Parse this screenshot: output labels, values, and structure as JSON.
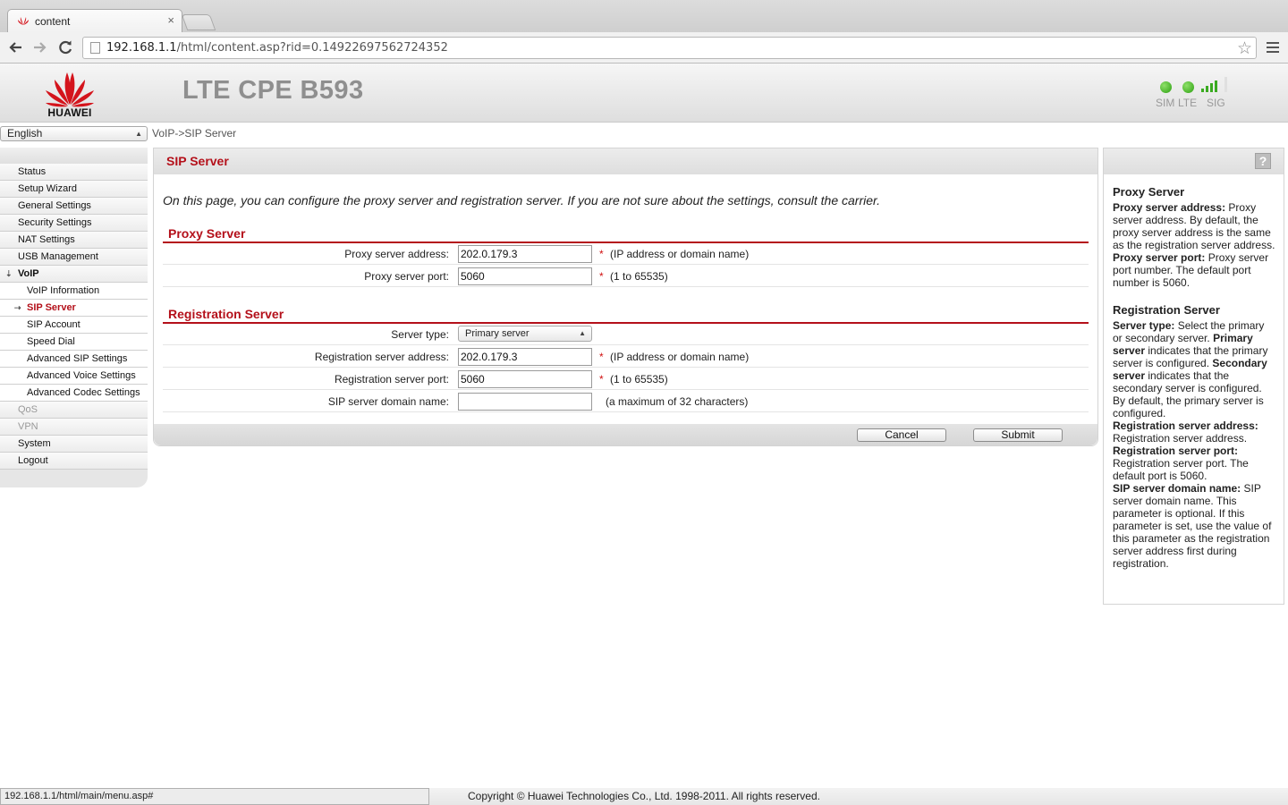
{
  "browser": {
    "tab_title": "content",
    "tab_close": "×",
    "url_host": "192.168.1.1",
    "url_path": "/html/content.asp?rid=0.14922697562724352",
    "status_url": "192.168.1.1/html/main/menu.asp#"
  },
  "header": {
    "brand": "HUAWEI",
    "product": "LTE CPE B593",
    "indicators": [
      {
        "label": "SIM",
        "color": "#2ba010"
      },
      {
        "label": "LTE",
        "color": "#2ba010"
      },
      {
        "label": "SIG",
        "bars_filled": 4,
        "bars_total": 5
      }
    ]
  },
  "language": {
    "selected": "English"
  },
  "breadcrumb": "VoIP->SIP Server",
  "sidebar": {
    "items": [
      {
        "label": "Status",
        "type": "top"
      },
      {
        "label": "Setup Wizard",
        "type": "top"
      },
      {
        "label": "General Settings",
        "type": "top"
      },
      {
        "label": "Security Settings",
        "type": "top"
      },
      {
        "label": "NAT Settings",
        "type": "top"
      },
      {
        "label": "USB Management",
        "type": "top"
      },
      {
        "label": "VoIP",
        "type": "group"
      },
      {
        "label": "VoIP Information",
        "type": "sub"
      },
      {
        "label": "SIP Server",
        "type": "sub-active"
      },
      {
        "label": "SIP Account",
        "type": "sub"
      },
      {
        "label": "Speed Dial",
        "type": "sub"
      },
      {
        "label": "Advanced SIP Settings",
        "type": "sub"
      },
      {
        "label": "Advanced Voice Settings",
        "type": "sub"
      },
      {
        "label": "Advanced Codec Settings",
        "type": "sub"
      },
      {
        "label": "QoS",
        "type": "disabled"
      },
      {
        "label": "VPN",
        "type": "disabled"
      },
      {
        "label": "System",
        "type": "top"
      },
      {
        "label": "Logout",
        "type": "top"
      }
    ]
  },
  "main": {
    "title": "SIP Server",
    "intro": "On this page, you can configure the proxy server and registration server. If you are not sure about the settings, consult the carrier.",
    "proxy": {
      "title": "Proxy Server",
      "address_label": "Proxy server address:",
      "address_value": "202.0.179.3",
      "address_hint": "(IP address or domain name)",
      "port_label": "Proxy server port:",
      "port_value": "5060",
      "port_hint": "(1 to 65535)"
    },
    "registration": {
      "title": "Registration Server",
      "type_label": "Server type:",
      "type_value": "Primary server",
      "address_label": "Registration server address:",
      "address_value": "202.0.179.3",
      "address_hint": "(IP address or domain name)",
      "port_label": "Registration server port:",
      "port_value": "5060",
      "port_hint": "(1 to 65535)",
      "domain_label": "SIP server domain name:",
      "domain_value": "",
      "domain_hint": "(a maximum of 32 characters)"
    },
    "required_mark": "*",
    "cancel_label": "Cancel",
    "submit_label": "Submit"
  },
  "help": {
    "proxy_title": "Proxy Server",
    "proxy_addr_term": "Proxy server address:",
    "proxy_addr_text": " Proxy server address. By default, the proxy server address is the same as the registration server address.",
    "proxy_port_term": "Proxy server port:",
    "proxy_port_text": " Proxy server port number. The default port number is 5060.",
    "reg_title": "Registration Server",
    "type_term": "Server type:",
    "type_text1": " Select the primary or secondary server. ",
    "type_primary_term": "Primary server",
    "type_text2": " indicates that the primary server is configured. ",
    "type_secondary_term": "Secondary server",
    "type_text3": " indicates that the secondary server is configured. By default, the primary server is configured.",
    "reg_addr_term": "Registration server address:",
    "reg_addr_text": " Registration server address.",
    "reg_port_term": "Registration server port:",
    "reg_port_text": " Registration server port. The default port is 5060.",
    "domain_term": "SIP server domain name:",
    "domain_text": " SIP server domain name. This parameter is optional. If this parameter is set, use the value of this parameter as the registration server address first during registration."
  },
  "footer": {
    "copyright": "Copyright © Huawei Technologies Co., Ltd. 1998-2011. All rights reserved."
  }
}
